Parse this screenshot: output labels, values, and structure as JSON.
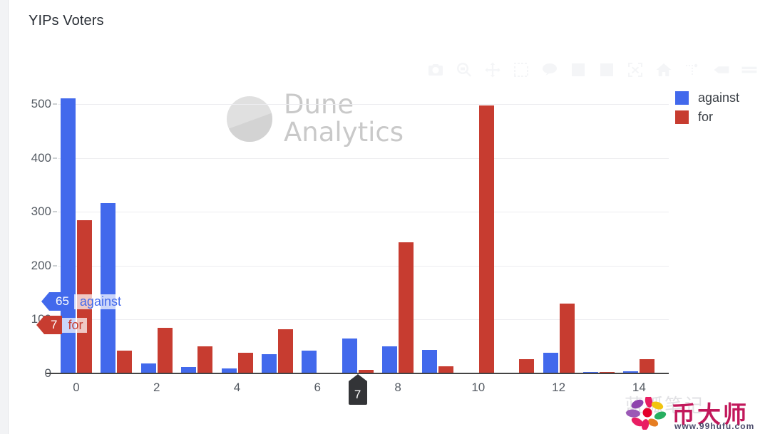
{
  "panel": {
    "title": "YIPs Voters"
  },
  "modebar": {
    "buttons": [
      {
        "name": "download-plot-icon",
        "label": "Download plot as a png"
      },
      {
        "name": "zoom-icon",
        "label": "Zoom"
      },
      {
        "name": "pan-icon",
        "label": "Pan"
      },
      {
        "name": "box-select-icon",
        "label": "Box Select"
      },
      {
        "name": "lasso-select-icon",
        "label": "Lasso Select"
      },
      {
        "name": "zoom-in-icon",
        "label": "Zoom in"
      },
      {
        "name": "zoom-out-icon",
        "label": "Zoom out"
      },
      {
        "name": "autoscale-icon",
        "label": "Autoscale"
      },
      {
        "name": "reset-axes-icon",
        "label": "Reset axes"
      },
      {
        "name": "toggle-spike-lines-icon",
        "label": "Toggle Spike Lines"
      },
      {
        "name": "hover-compare-icon",
        "label": "Show closest data on hover"
      },
      {
        "name": "hover-closest-icon",
        "label": "Compare data on hover"
      }
    ]
  },
  "legend": {
    "items": [
      {
        "label": "against",
        "color": "#4269ec"
      },
      {
        "label": "for",
        "color": "#c73c30"
      }
    ]
  },
  "tooltip": {
    "x_marker": "7",
    "rows": [
      {
        "value": "65",
        "label": "against",
        "color": "#4269ec"
      },
      {
        "value": "7",
        "label": "for",
        "color": "#c73c30"
      }
    ]
  },
  "watermark": {
    "dune_line1": "Dune",
    "dune_line2": "Analytics",
    "site_ghost": "蓝狐笔记",
    "site_name": "币大师",
    "site_url": "www.99hufu.com"
  },
  "chart_data": {
    "type": "bar",
    "title": "YIPs Voters",
    "xlabel": "",
    "ylabel": "",
    "grid": true,
    "legend_position": "right",
    "barmode": "group",
    "ylim": [
      0,
      530
    ],
    "yticks": [
      0,
      100,
      200,
      300,
      400,
      500
    ],
    "xticks": [
      0,
      2,
      4,
      6,
      8,
      10,
      12,
      14
    ],
    "categories": [
      0,
      1,
      2,
      3,
      4,
      5,
      6,
      7,
      8,
      9,
      10,
      11,
      12,
      13,
      14
    ],
    "series": [
      {
        "name": "against",
        "color": "#4269ec",
        "values": [
          510,
          316,
          19,
          12,
          9,
          36,
          43,
          65,
          50,
          44,
          0,
          0,
          38,
          3,
          4
        ]
      },
      {
        "name": "for",
        "color": "#c73c30",
        "values": [
          284,
          43,
          85,
          50,
          38,
          82,
          0,
          7,
          243,
          13,
          497,
          26,
          129,
          2,
          26
        ]
      }
    ]
  }
}
